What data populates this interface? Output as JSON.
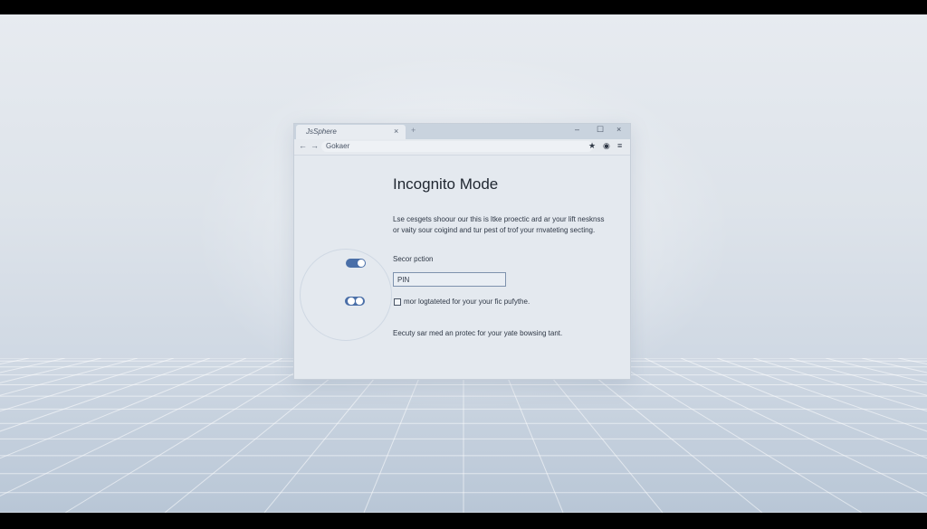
{
  "browser": {
    "tab_title": "JsSphere",
    "tab_close": "×",
    "new_tab": "+",
    "window_controls": {
      "minimize": "–",
      "maximize": "☐",
      "close": "×"
    },
    "nav": {
      "back": "←",
      "forward": "→"
    },
    "address": "Gokaer",
    "toolbar_icons": {
      "star": "★",
      "shield": "◉",
      "menu": "≡"
    }
  },
  "page": {
    "title": "Incognito Mode",
    "description_line1": "Lse cesgets shoour our this is ltke proectic ard ar your lift nesknss",
    "description_line2": "or vaity sour coigind and tur pest of trof your rnvateting secting.",
    "section_label": "Secor pction",
    "pin_value": "PIN",
    "checkbox_label": "mor logtateted for your your fic pufythe.",
    "checkbox_checked": false,
    "footer": "Eecuty sar med an protec for your yate bowsing tant.",
    "toggles": [
      {
        "state": "on"
      },
      {
        "state": "off"
      }
    ]
  },
  "colors": {
    "accent": "#4a6fa8",
    "background": "#dde3ea"
  }
}
